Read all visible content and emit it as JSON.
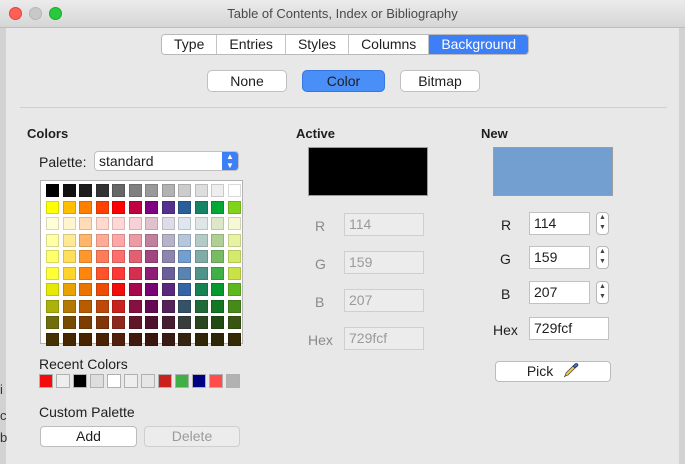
{
  "window": {
    "title": "Table of Contents, Index or Bibliography"
  },
  "tabs": [
    {
      "label": "Type",
      "active": false
    },
    {
      "label": "Entries",
      "active": false
    },
    {
      "label": "Styles",
      "active": false
    },
    {
      "label": "Columns",
      "active": false
    },
    {
      "label": "Background",
      "active": true
    }
  ],
  "fill_buttons": {
    "none": "None",
    "color": "Color",
    "bitmap": "Bitmap",
    "selected": "Color"
  },
  "colors_section": {
    "heading": "Colors",
    "palette_label": "Palette:",
    "palette_value": "standard",
    "swatches": [
      [
        "#000000",
        "#111111",
        "#1c1c1c",
        "#333333",
        "#666666",
        "#808080",
        "#999999",
        "#b2b2b2",
        "#cccccc",
        "#dddddd",
        "#eeeeee",
        "#ffffff"
      ],
      [
        "#ffff00",
        "#ffbf00",
        "#ff8000",
        "#ff4000",
        "#ff0000",
        "#bf0041",
        "#800080",
        "#55308d",
        "#2a6099",
        "#158466",
        "#00a933",
        "#81d41a"
      ],
      [
        "#ffffd7",
        "#fff5ce",
        "#ffdbb6",
        "#ffd8ce",
        "#ffd7d7",
        "#f7d1d5",
        "#e0c2cd",
        "#dedce6",
        "#dee6ef",
        "#dee7e5",
        "#dde8cb",
        "#f6f9d4"
      ],
      [
        "#ffffa6",
        "#ffe994",
        "#ffb66c",
        "#ffaa95",
        "#ffa6a6",
        "#ec9ba4",
        "#bf819e",
        "#b7b3ca",
        "#b4c7dc",
        "#b3cac7",
        "#afd095",
        "#e8f2a1"
      ],
      [
        "#ffff6d",
        "#ffde59",
        "#ff972f",
        "#ff7b59",
        "#ff6d6d",
        "#e16173",
        "#a1467e",
        "#8e86ae",
        "#729fcf",
        "#81aca6",
        "#77bc65",
        "#d4ea6b"
      ],
      [
        "#ffff38",
        "#ffd428",
        "#ff860d",
        "#ff5429",
        "#ff3838",
        "#d62e4e",
        "#8d1d75",
        "#6b5e9b",
        "#5983b0",
        "#50938a",
        "#3faf46",
        "#c9e346"
      ],
      [
        "#e6e905",
        "#e8a202",
        "#ea7500",
        "#ed4c05",
        "#f10d0c",
        "#a7074b",
        "#780373",
        "#5b277d",
        "#3465a4",
        "#168253",
        "#069a2e",
        "#5eb91e"
      ],
      [
        "#acb20c",
        "#b47804",
        "#b85c00",
        "#be480a",
        "#c9211e",
        "#861141",
        "#650953",
        "#55215b",
        "#355269",
        "#1e6a39",
        "#127622",
        "#468a1a"
      ],
      [
        "#706e0c",
        "#784b04",
        "#7b3d00",
        "#813709",
        "#8d281e",
        "#611729",
        "#4e102d",
        "#481d32",
        "#383d3c",
        "#28471f",
        "#224b12",
        "#395511"
      ],
      [
        "#443205",
        "#472702",
        "#492300",
        "#4b2204",
        "#50200c",
        "#41190d",
        "#3b160e",
        "#3a1a14",
        "#362413",
        "#302709",
        "#2e2706",
        "#342a06"
      ]
    ],
    "recent_label": "Recent Colors",
    "recent_swatches": [
      "#f10d0c",
      "#eeeeee",
      "#000000",
      "#dddddd",
      "#ffffff",
      "#eeeeee",
      "#e6e6e6",
      "#c9211e",
      "#3faf46",
      "#000080",
      "#ff4c4c",
      "#b2b2b2"
    ],
    "custom_palette_label": "Custom Palette",
    "add_label": "Add",
    "delete_label": "Delete"
  },
  "active": {
    "heading": "Active",
    "preview_color": "#000000",
    "r_label": "R",
    "r_value": "114",
    "g_label": "G",
    "g_value": "159",
    "b_label": "B",
    "b_value": "207",
    "hex_label": "Hex",
    "hex_value": "729fcf"
  },
  "new": {
    "heading": "New",
    "preview_color": "#729fcf",
    "r_label": "R",
    "r_value": "114",
    "g_label": "G",
    "g_value": "159",
    "b_label": "B",
    "b_value": "207",
    "hex_label": "Hex",
    "hex_value": "729fcf",
    "pick_label": "Pick"
  },
  "background_edge_glyphs": [
    "i",
    "c",
    "b"
  ]
}
